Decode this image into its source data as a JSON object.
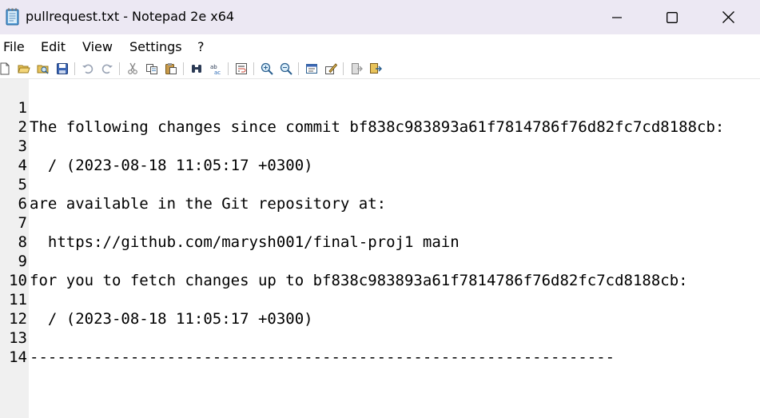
{
  "window": {
    "title": "pullrequest.txt - Notepad 2e x64"
  },
  "menu": {
    "items": [
      "File",
      "Edit",
      "View",
      "Settings",
      "?"
    ]
  },
  "toolbar": {
    "buttons": [
      "new-file-icon",
      "open-folder-icon",
      "browse-icon",
      "save-icon",
      "undo-icon",
      "redo-icon",
      "cut-icon",
      "copy-icon",
      "paste-icon",
      "find-icon",
      "replace-icon",
      "word-wrap-icon",
      "zoom-in-icon",
      "zoom-out-icon",
      "scheme-icon",
      "customize-icon",
      "exit-icon",
      "save-exit-icon"
    ]
  },
  "editor": {
    "lines": [
      {
        "num": "1",
        "text": "The following changes since commit bf838c983893a61f7814786f76d82fc7cd8188cb:"
      },
      {
        "num": "2",
        "text": ""
      },
      {
        "num": "3",
        "text": "  / (2023-08-18 11:05:17 +0300)"
      },
      {
        "num": "4",
        "text": ""
      },
      {
        "num": "5",
        "text": "are available in the Git repository at:"
      },
      {
        "num": "6",
        "text": ""
      },
      {
        "num": "7",
        "text": "  https://github.com/marysh001/final-proj1 main"
      },
      {
        "num": "8",
        "text": ""
      },
      {
        "num": "9",
        "text": "for you to fetch changes up to bf838c983893a61f7814786f76d82fc7cd8188cb:"
      },
      {
        "num": "10",
        "text": ""
      },
      {
        "num": "11",
        "text": "  / (2023-08-18 11:05:17 +0300)"
      },
      {
        "num": "12",
        "text": ""
      },
      {
        "num": "13",
        "text": "----------------------------------------------------------------"
      },
      {
        "num": "14",
        "text": ""
      }
    ]
  },
  "colors": {
    "titlebar_bg": "#ece8f3",
    "gutter_bg": "#f0f0f0",
    "text": "#000000"
  }
}
